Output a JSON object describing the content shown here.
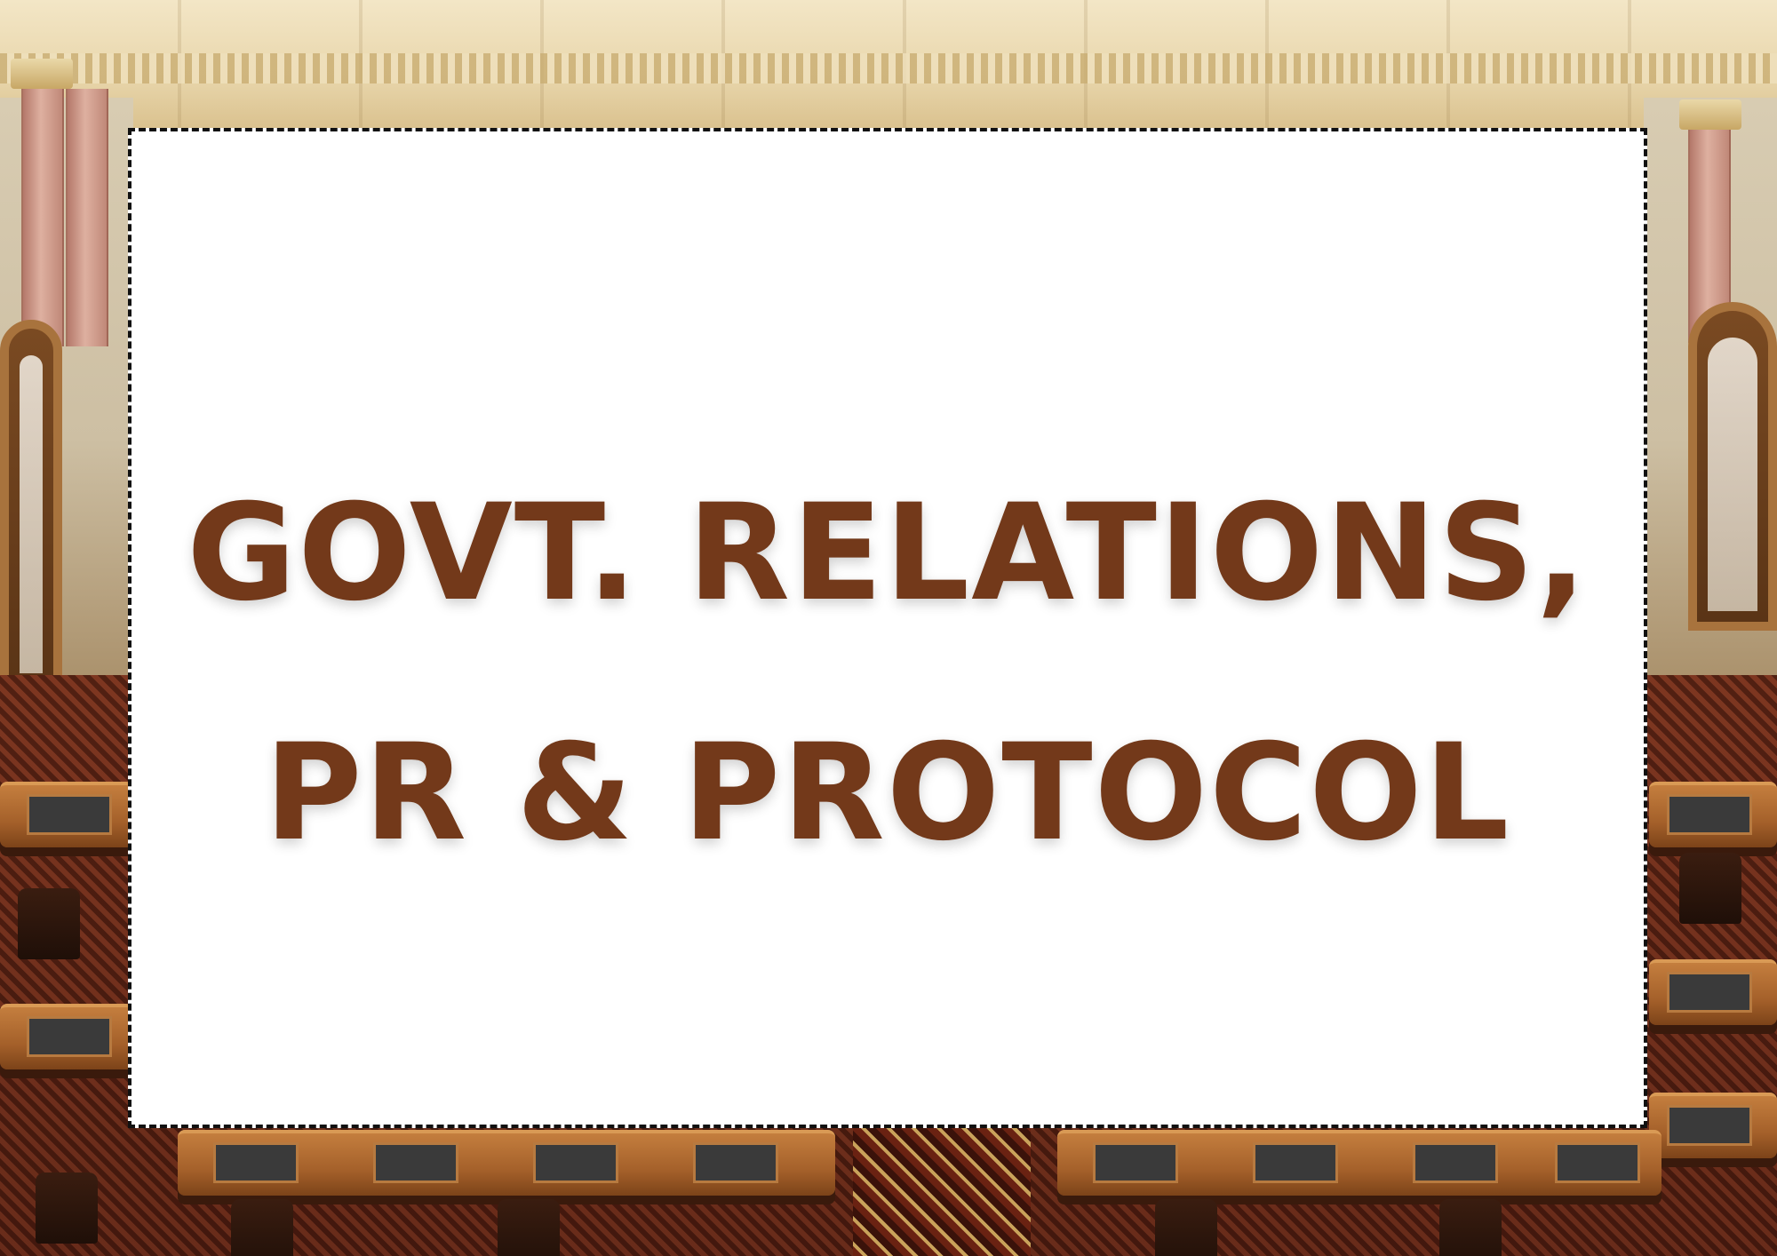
{
  "banner": {
    "line1": "GOVT. RELATIONS,",
    "line2": "PR & PROTOCOL"
  },
  "colors": {
    "title_text": "#73391a",
    "card_background": "#ffffff",
    "card_border": "#111111"
  },
  "background": {
    "description_icon": "legislative-chamber-photo"
  }
}
